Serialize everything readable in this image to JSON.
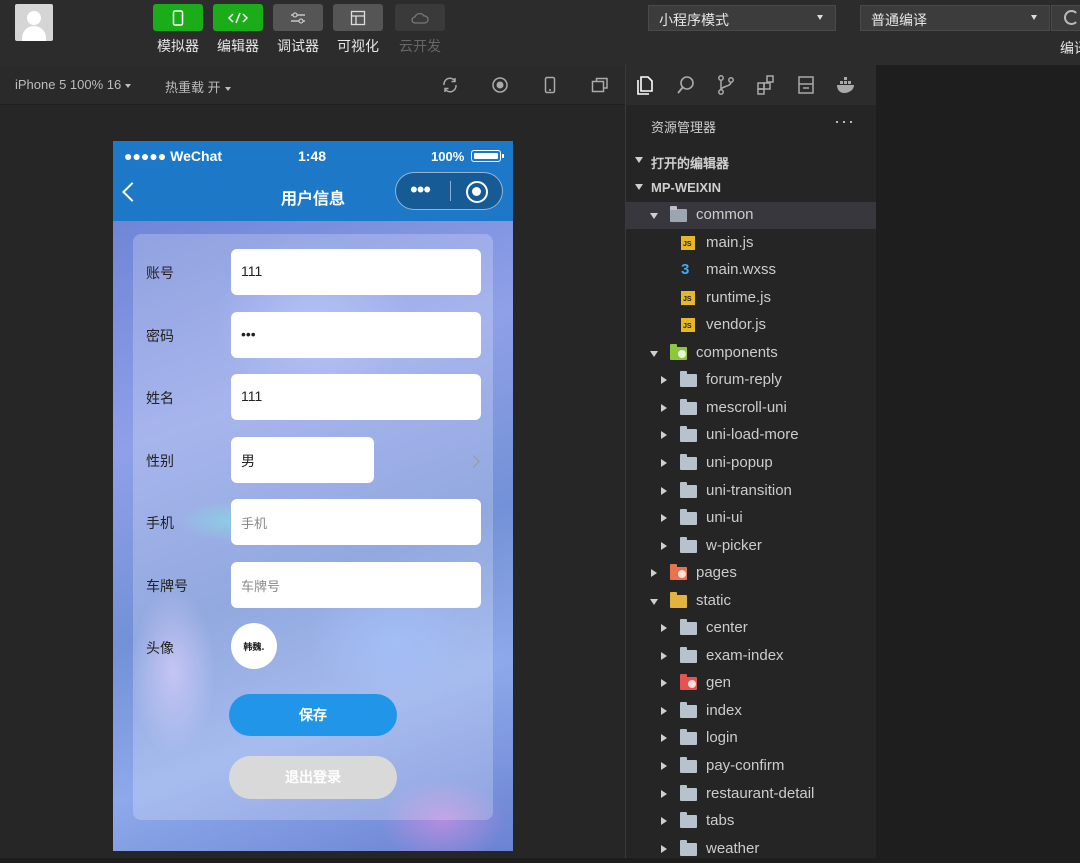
{
  "toolbar": {
    "tools": [
      {
        "label": "模拟器",
        "icon": "phone-icon",
        "style": "green"
      },
      {
        "label": "编辑器",
        "icon": "code-icon",
        "style": "green"
      },
      {
        "label": "调试器",
        "icon": "debug-sliders-icon",
        "style": "grey"
      },
      {
        "label": "可视化",
        "icon": "layout-icon",
        "style": "grey"
      },
      {
        "label": "云开发",
        "icon": "cloud-icon",
        "style": "disabled"
      }
    ],
    "mode_select": "小程序模式",
    "compile_select": "普通编译",
    "compile_label": "编译"
  },
  "simbar": {
    "device": "iPhone 5 100% 16",
    "hot_reload": "热重载 开"
  },
  "phone": {
    "status": {
      "signal": "●●●●● WeChat",
      "time": "1:48",
      "battery": "100%"
    },
    "nav_title": "用户信息",
    "capsule_dots": "•••",
    "form": {
      "account_label": "账号",
      "account_value": "111",
      "password_label": "密码",
      "password_value": "•••",
      "name_label": "姓名",
      "name_value": "111",
      "gender_label": "性别",
      "gender_value": "男",
      "phone_label": "手机",
      "phone_placeholder": "手机",
      "plate_label": "车牌号",
      "plate_placeholder": "车牌号",
      "avatar_label": "头像",
      "avatar_text": "韩魏."
    },
    "save_button": "保存",
    "logout_button": "退出登录"
  },
  "explorer": {
    "title": "资源管理器",
    "more": "···",
    "open_editors": "打开的编辑器",
    "project": "MP-WEIXIN",
    "tree": [
      {
        "name": "common",
        "type": "folder-open",
        "indent": 1,
        "expanded": true,
        "selected": true
      },
      {
        "name": "main.js",
        "type": "js",
        "indent": 2
      },
      {
        "name": "main.wxss",
        "type": "css",
        "indent": 2
      },
      {
        "name": "runtime.js",
        "type": "js",
        "indent": 2
      },
      {
        "name": "vendor.js",
        "type": "js",
        "indent": 2
      },
      {
        "name": "components",
        "type": "folder-green",
        "indent": 1,
        "expanded": true
      },
      {
        "name": "forum-reply",
        "type": "folder",
        "indent": 2
      },
      {
        "name": "mescroll-uni",
        "type": "folder",
        "indent": 2
      },
      {
        "name": "uni-load-more",
        "type": "folder",
        "indent": 2
      },
      {
        "name": "uni-popup",
        "type": "folder",
        "indent": 2
      },
      {
        "name": "uni-transition",
        "type": "folder",
        "indent": 2
      },
      {
        "name": "uni-ui",
        "type": "folder",
        "indent": 2
      },
      {
        "name": "w-picker",
        "type": "folder",
        "indent": 2
      },
      {
        "name": "pages",
        "type": "folder-orange",
        "indent": 1
      },
      {
        "name": "static",
        "type": "folder-yellow",
        "indent": 1,
        "expanded": true
      },
      {
        "name": "center",
        "type": "folder",
        "indent": 2
      },
      {
        "name": "exam-index",
        "type": "folder",
        "indent": 2
      },
      {
        "name": "gen",
        "type": "folder-red",
        "indent": 2
      },
      {
        "name": "index",
        "type": "folder",
        "indent": 2
      },
      {
        "name": "login",
        "type": "folder",
        "indent": 2
      },
      {
        "name": "pay-confirm",
        "type": "folder",
        "indent": 2
      },
      {
        "name": "restaurant-detail",
        "type": "folder",
        "indent": 2
      },
      {
        "name": "tabs",
        "type": "folder",
        "indent": 2
      },
      {
        "name": "weather",
        "type": "folder",
        "indent": 2
      }
    ]
  }
}
